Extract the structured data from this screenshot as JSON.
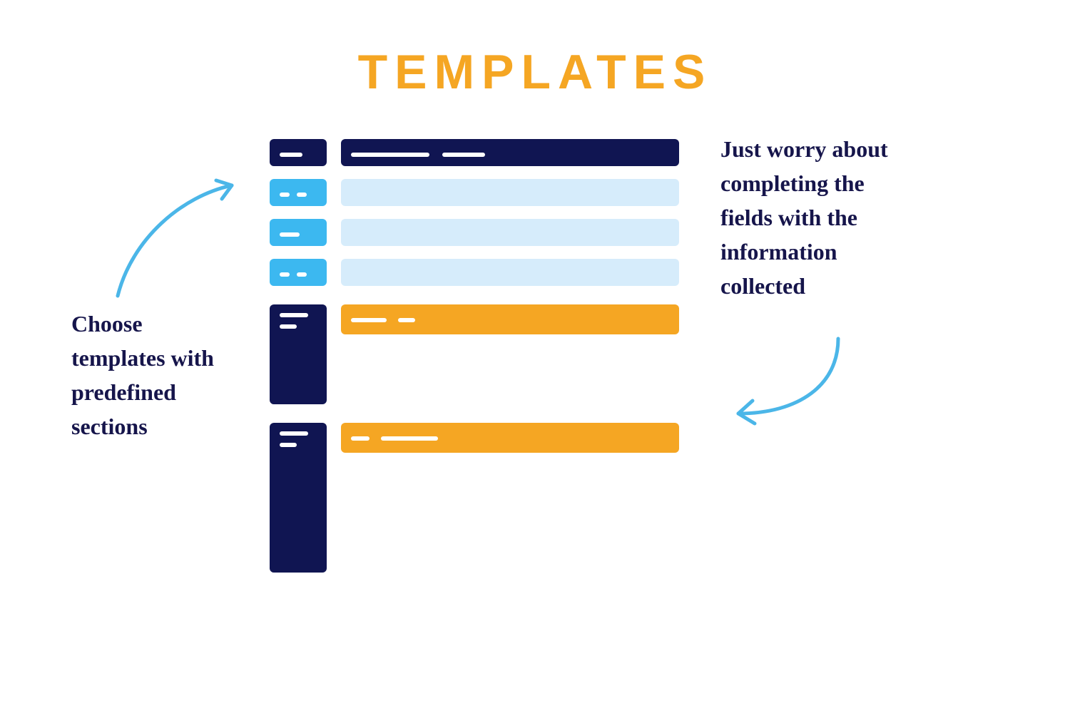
{
  "title": "TEMPLATES",
  "captions": {
    "left": "Choose templates with predefined sections",
    "right": "Just worry about completing the fields with the information collected"
  },
  "colors": {
    "navy": "#101552",
    "sky": "#3cb8f0",
    "pale": "#d6ecfb",
    "gold": "#f5a623",
    "arrow": "#4bb6e8"
  }
}
